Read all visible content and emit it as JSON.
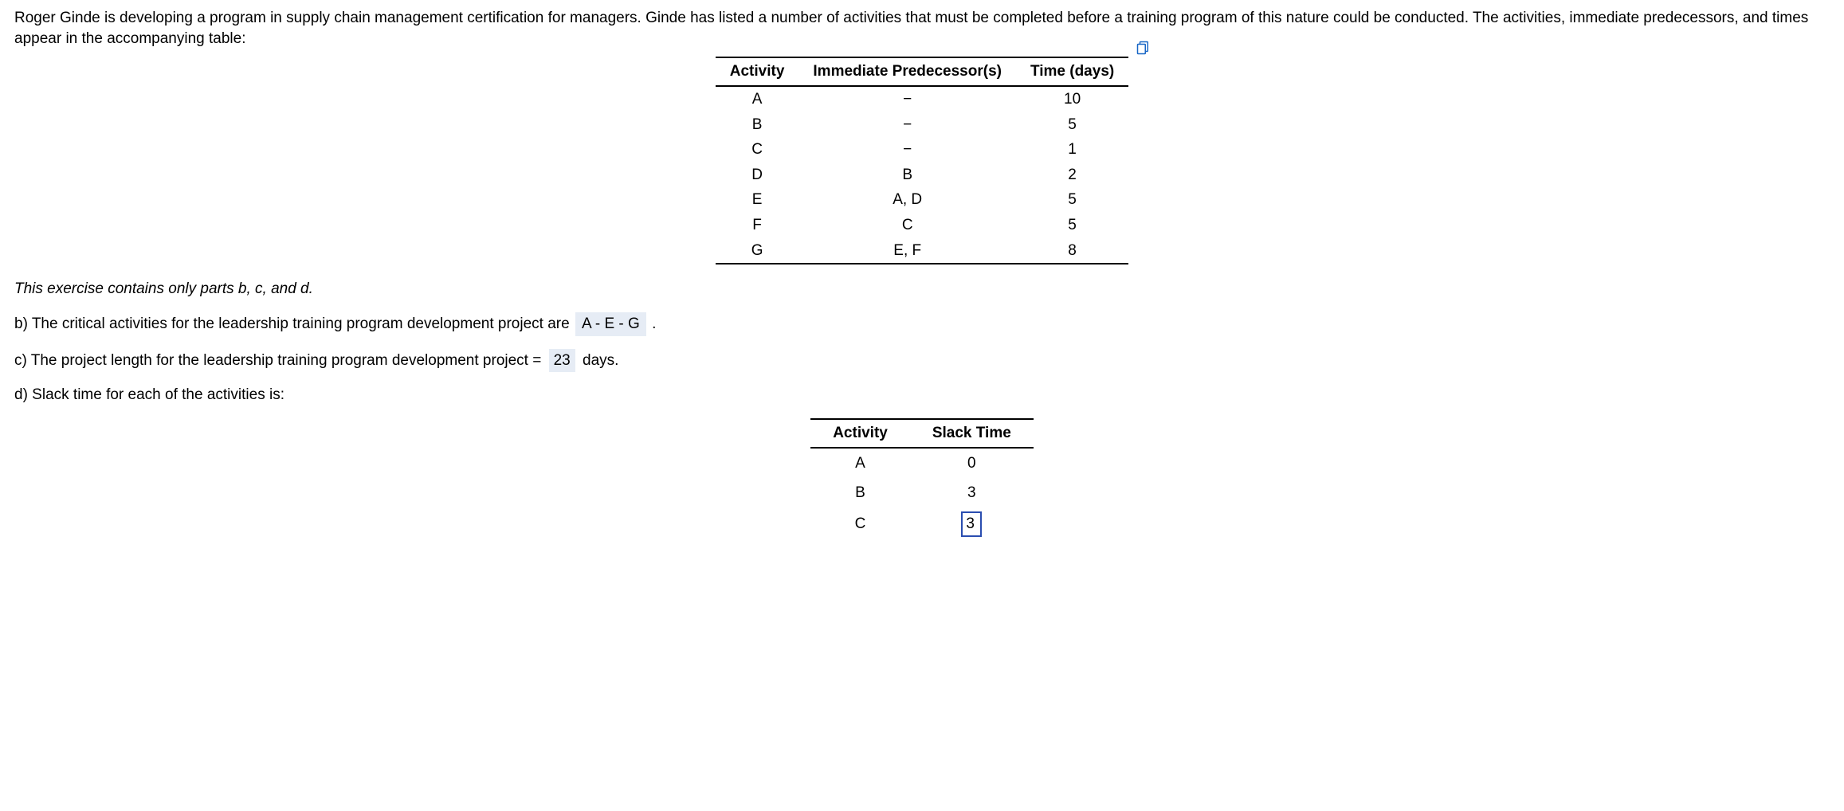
{
  "intro": {
    "line1": "Roger Ginde is developing a program in supply chain management certification for managers. Ginde has listed a number of activities that must be completed before a training program of this nature could be conducted. The activities, immediate predecessors, and times appear in the accompanying table:"
  },
  "activity_table": {
    "headers": {
      "activity": "Activity",
      "pred": "Immediate Predecessor(s)",
      "time": "Time (days)"
    },
    "rows": [
      {
        "activity": "A",
        "pred": "−",
        "time": "10"
      },
      {
        "activity": "B",
        "pred": "−",
        "time": "5"
      },
      {
        "activity": "C",
        "pred": "−",
        "time": "1"
      },
      {
        "activity": "D",
        "pred": "B",
        "time": "2"
      },
      {
        "activity": "E",
        "pred": "A, D",
        "time": "5"
      },
      {
        "activity": "F",
        "pred": "C",
        "time": "5"
      },
      {
        "activity": "G",
        "pred": "E, F",
        "time": "8"
      }
    ]
  },
  "note": "This exercise contains only parts b, c, and d.",
  "partB": {
    "prefix": "b) The critical activities for the leadership training program development project are ",
    "value": "A - E - G",
    "suffix": "."
  },
  "partC": {
    "prefix": "c) The project length for the leadership training program development project = ",
    "value": "23",
    "suffix": " days."
  },
  "partD": {
    "text": "d) Slack time for each of the activities is:"
  },
  "slack_table": {
    "headers": {
      "activity": "Activity",
      "slack": "Slack Time"
    },
    "rows": [
      {
        "activity": "A",
        "slack": "0",
        "editable": false
      },
      {
        "activity": "B",
        "slack": "3",
        "editable": false
      },
      {
        "activity": "C",
        "slack": "3",
        "editable": true
      }
    ]
  },
  "icons": {
    "copy": "copy-icon"
  }
}
